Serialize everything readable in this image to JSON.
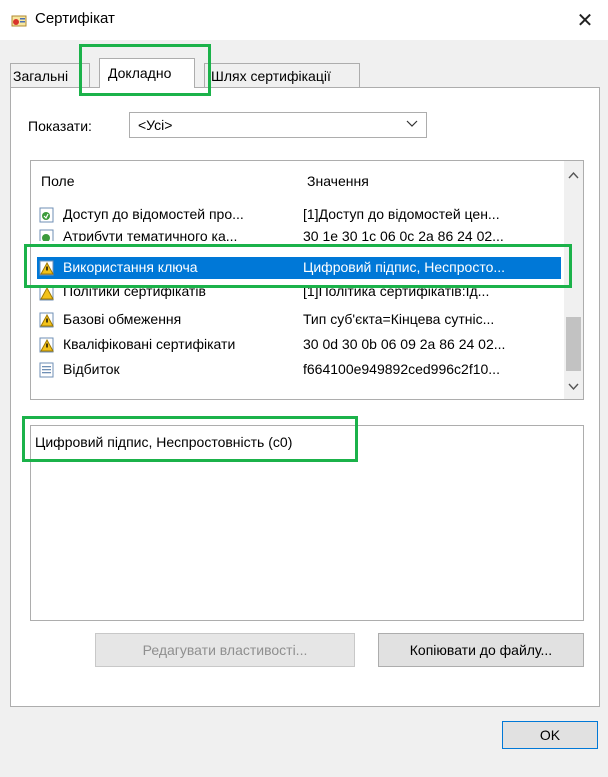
{
  "window": {
    "title": "Сертифікат",
    "close_glyph": "✕"
  },
  "tabs": [
    {
      "label": "Загальні",
      "active": false
    },
    {
      "label": "Докладно",
      "active": true
    },
    {
      "label": "Шлях сертифікації",
      "active": false
    }
  ],
  "show": {
    "label": "Показати:",
    "selected": "<Усі>"
  },
  "list": {
    "columns": [
      "Поле",
      "Значення"
    ],
    "rows": [
      {
        "field": "Доступ до відомостей про...",
        "value": "[1]Доступ до відомостей цен...",
        "icon": "cert-field-icon",
        "selected": false
      },
      {
        "field": "Атрибути тематичного ка...",
        "value": "30 1e 30 1c 06 0c 2a 86 24 02...",
        "icon": "cert-field-icon",
        "selected": false
      },
      {
        "field": "Використання ключа",
        "value": "Цифровий підпис, Неспросто...",
        "icon": "critical-extension-icon",
        "selected": true
      },
      {
        "field": "Політики сертифікатів",
        "value": "[1]Політика сертифікатів:Ід...",
        "icon": "critical-extension-icon",
        "selected": false
      },
      {
        "field": "Базові обмеження",
        "value": "Тип суб'єкта=Кінцева сутніс...",
        "icon": "critical-extension-icon",
        "selected": false
      },
      {
        "field": "Кваліфіковані сертифікати",
        "value": "30 0d 30 0b 06 09 2a 86 24 02...",
        "icon": "critical-extension-icon",
        "selected": false
      },
      {
        "field": "Відбиток",
        "value": "f664100e949892ced996c2f10...",
        "icon": "thumbprint-icon",
        "selected": false
      }
    ]
  },
  "detail": {
    "text": "Цифровий підпис, Неспростовність (c0)"
  },
  "buttons": {
    "edit_properties": "Редагувати властивості...",
    "copy_to_file": "Копіювати до файлу...",
    "ok": "OK"
  },
  "colors": {
    "highlight": "#1bb24a",
    "selection": "#0078d7"
  }
}
